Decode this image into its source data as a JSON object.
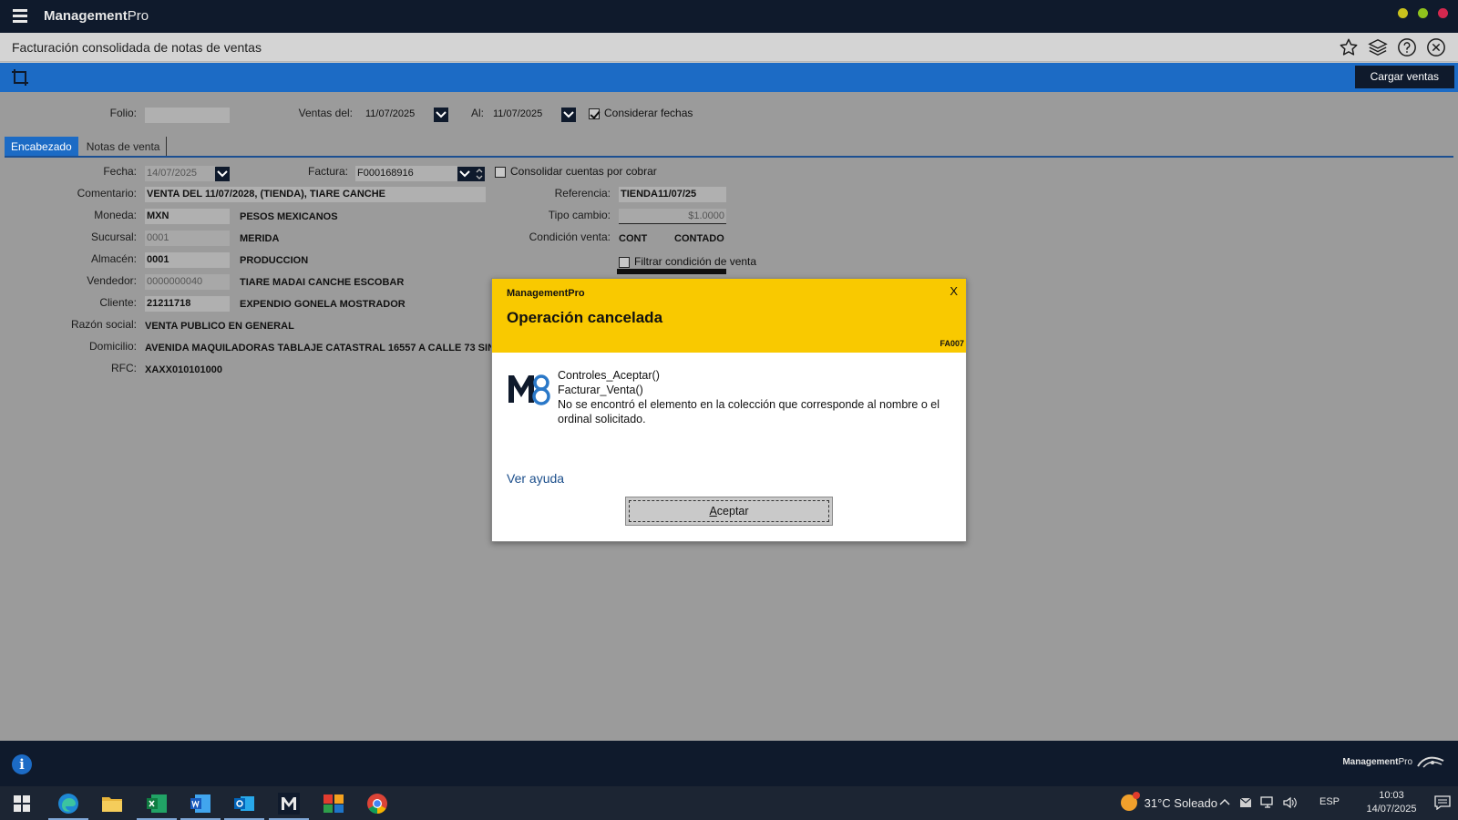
{
  "app": {
    "name_bold": "Management",
    "name_thin": "Pro",
    "window_dots": [
      "#c9c21d",
      "#8fc21d",
      "#d4284f"
    ]
  },
  "titlebar": {
    "title": "Facturación consolidada de notas de ventas"
  },
  "toolbar": {
    "load_button": "Cargar ventas"
  },
  "filter": {
    "folio_label": "Folio:",
    "folio_value": "",
    "ventas_del_label": "Ventas del:",
    "ventas_del_value": "11/07/2025",
    "al_label": "Al:",
    "al_value": "11/07/2025",
    "considerar_fechas_label": "Considerar fechas",
    "considerar_fechas_checked": true
  },
  "tabs": [
    {
      "label": "Encabezado"
    },
    {
      "label": "Notas de venta"
    }
  ],
  "form": {
    "fecha_label": "Fecha:",
    "fecha_value": "14/07/2025",
    "factura_label": "Factura:",
    "factura_value": "F000168916",
    "consolidar_label": "Consolidar cuentas por cobrar",
    "comentario_label": "Comentario:",
    "comentario_value": "VENTA DEL 11/07/2028, (TIENDA), TIARE CANCHE",
    "referencia_label": "Referencia:",
    "referencia_value": "TIENDA11/07/25",
    "moneda_label": "Moneda:",
    "moneda_code": "MXN",
    "moneda_name": "PESOS MEXICANOS",
    "tipo_cambio_label": "Tipo cambio:",
    "tipo_cambio_value": "$1.0000",
    "sucursal_label": "Sucursal:",
    "sucursal_code": "0001",
    "sucursal_name": "MERIDA",
    "condicion_label": "Condición venta:",
    "condicion_code": "CONT",
    "condicion_name": "CONTADO",
    "almacen_label": "Almacén:",
    "almacen_code": "0001",
    "almacen_name": "PRODUCCION",
    "filtrar_condicion_label": "Filtrar condición de venta",
    "vendedor_label": "Vendedor:",
    "vendedor_code": "0000000040",
    "vendedor_name": "TIARE MADAI CANCHE ESCOBAR",
    "cliente_label": "Cliente:",
    "cliente_code": "21211718",
    "cliente_name": "EXPENDIO GONELA MOSTRADOR",
    "razon_label": "Razón social:",
    "razon_value": "VENTA PUBLICO EN GENERAL",
    "domicilio_label": "Domicilio:",
    "domicilio_value": "AVENIDA MAQUILADORAS TABLAJE CATASTRAL 16557 A CALLE 73 SIN NOM",
    "rfc_label": "RFC:",
    "rfc_value": "XAXX010101000"
  },
  "modal": {
    "app": "ManagementPro",
    "title": "Operación cancelada",
    "close": "X",
    "code": "FA007",
    "lines": [
      "Controles_Aceptar()",
      "Facturar_Venta()",
      "No se encontró el elemento en la colección que corresponde al nombre o el ordinal solicitado."
    ],
    "help_link": "Ver ayuda",
    "accept_first": "A",
    "accept_rest": "ceptar"
  },
  "statusbar": {
    "brand_bold": "Management",
    "brand_thin": "Pro"
  },
  "taskbar": {
    "apps": [
      "edge-icon",
      "file-explorer-icon",
      "excel-icon",
      "word-icon",
      "outlook-icon",
      "managementpro-icon",
      "gallery-icon",
      "chrome-icon"
    ],
    "weather": "31°C  Soleado",
    "language": "ESP",
    "time": "10:03",
    "date": "14/07/2025"
  }
}
